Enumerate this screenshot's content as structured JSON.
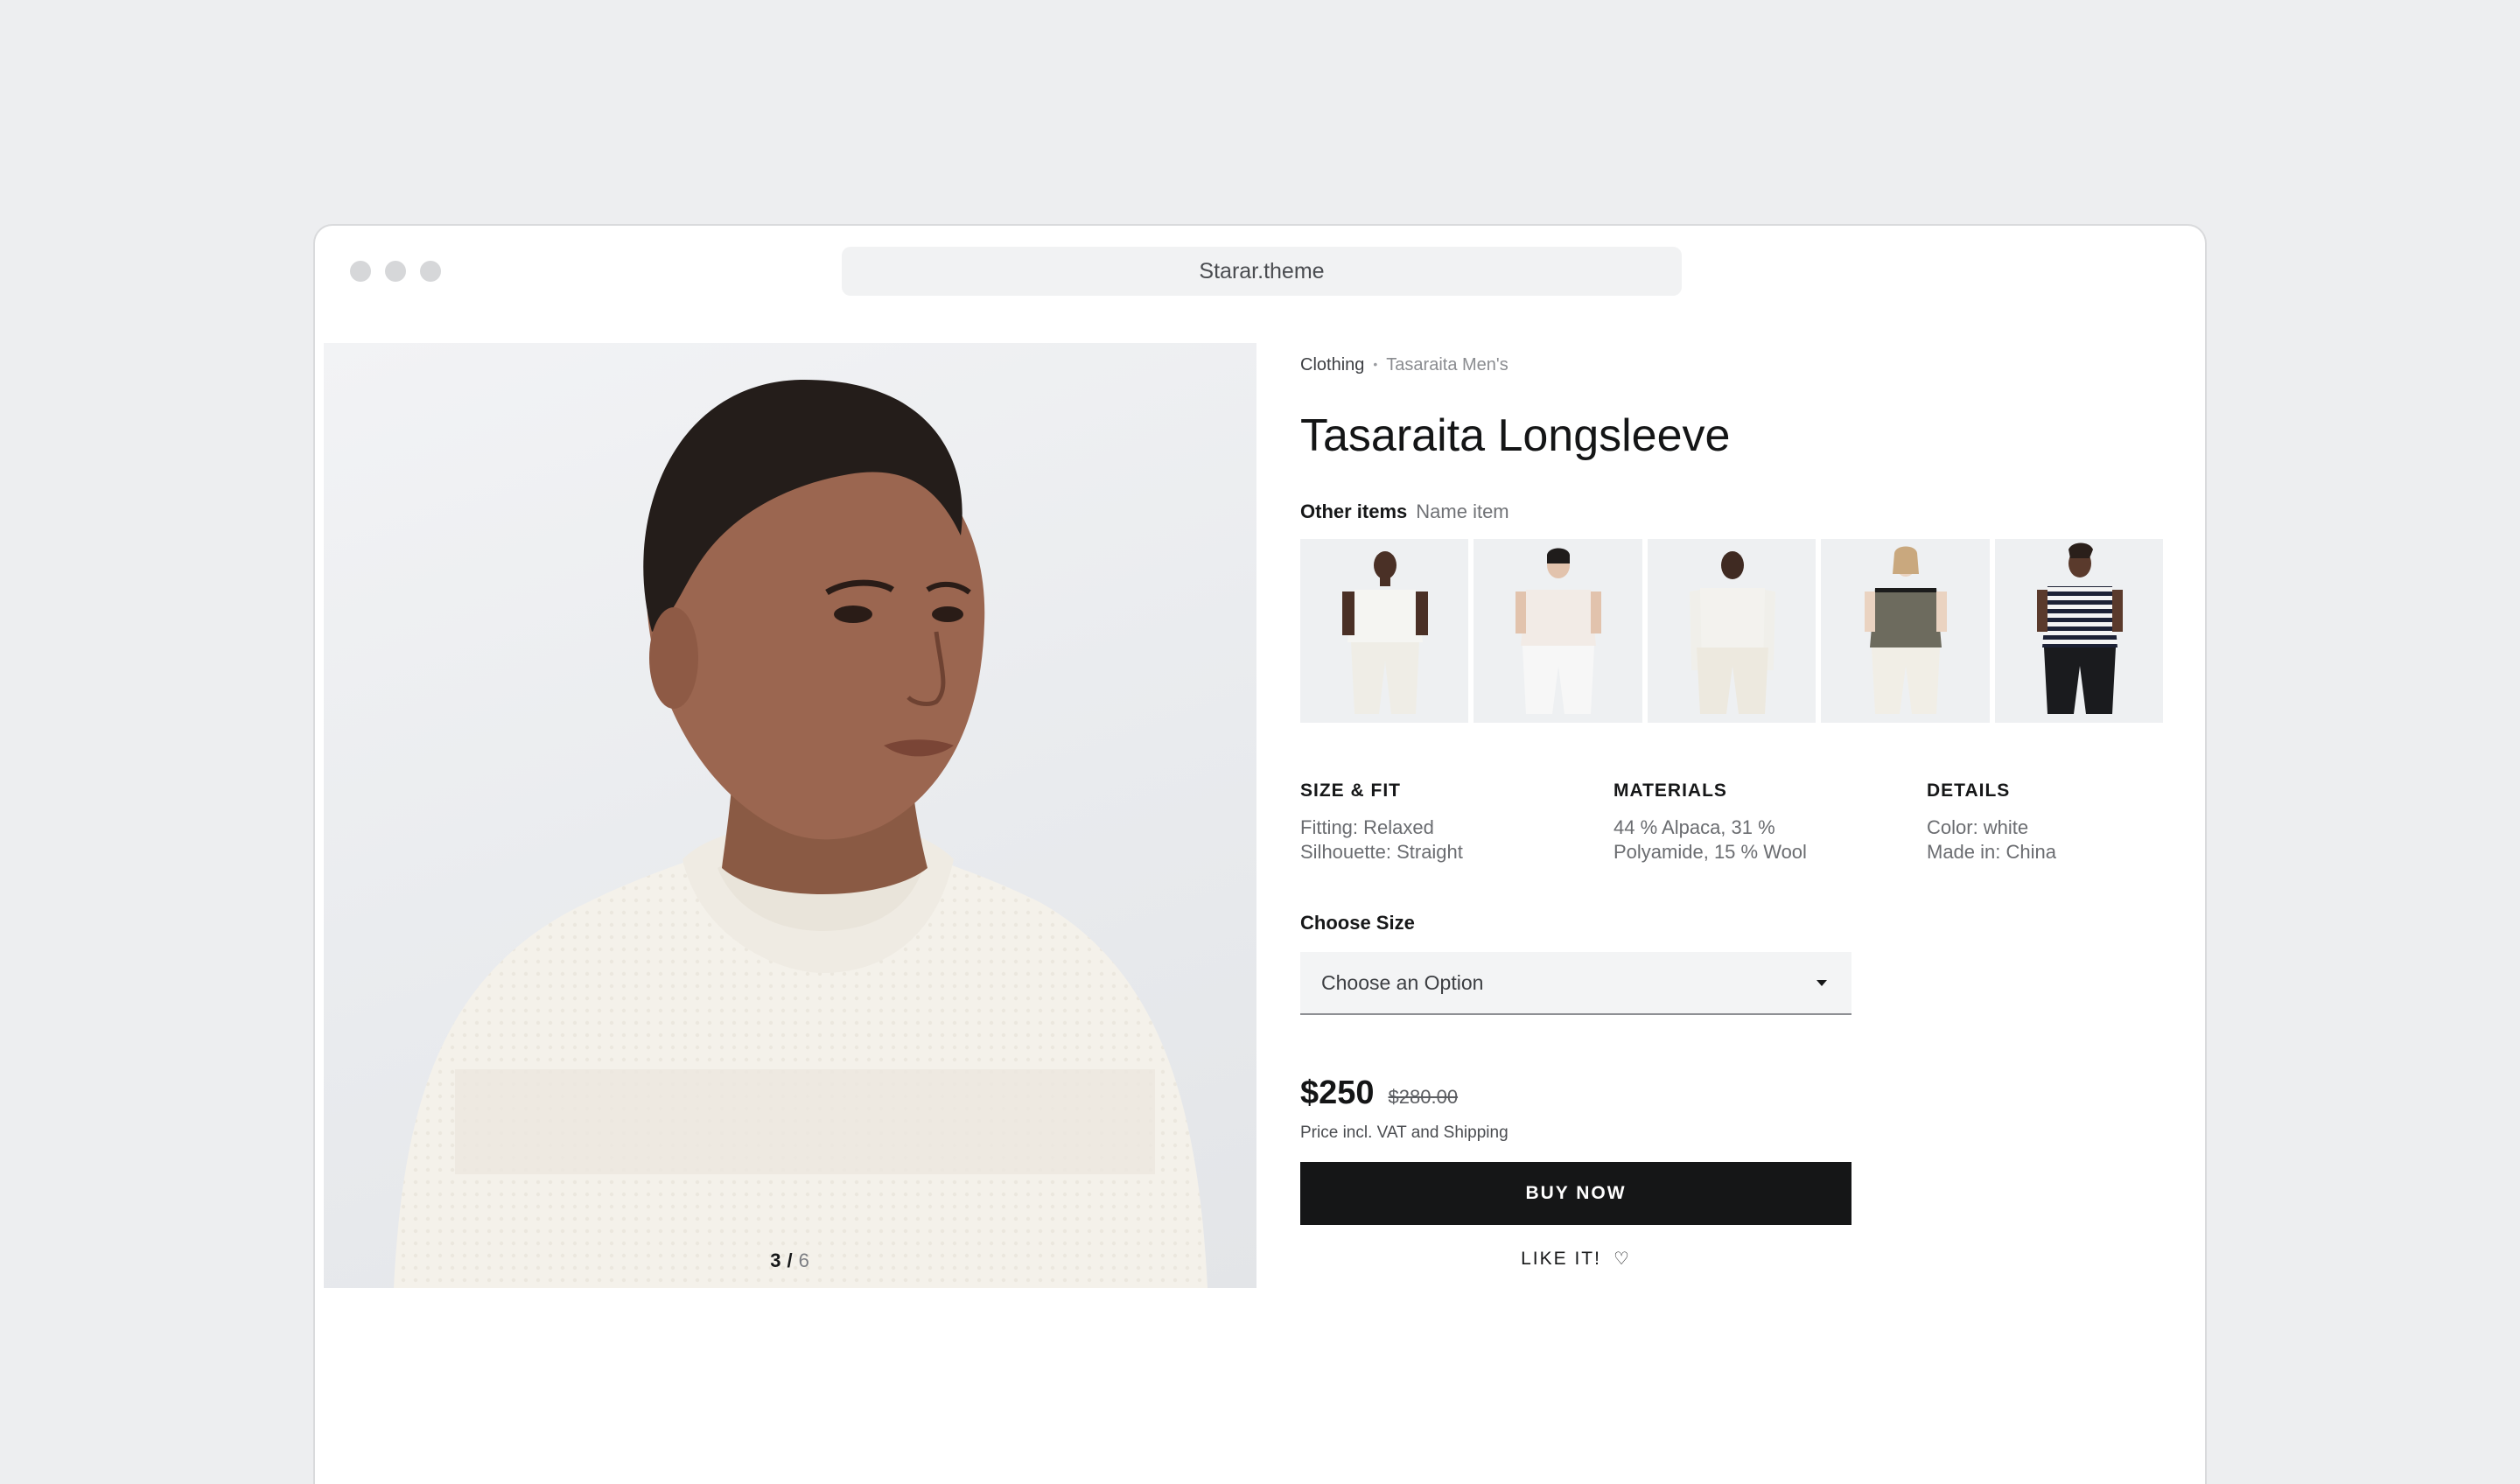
{
  "browser": {
    "address": "Starar.theme"
  },
  "gallery": {
    "current": "3",
    "separator": "/",
    "total": "6"
  },
  "breadcrumb": {
    "items": [
      "Clothing",
      "Tasaraita Men's"
    ],
    "separator": "•"
  },
  "product": {
    "title": "Tasaraita Longsleeve",
    "other_items_label": "Other items",
    "other_items_name": "Name item",
    "thumbnails": [
      "white-tee-model",
      "cream-tee-model",
      "white-longsleeve-model",
      "grey-ringer-tee-model",
      "striped-tee-model"
    ],
    "specs": [
      {
        "heading": "SIZE & FIT",
        "lines": [
          "Fitting: Relaxed",
          "Silhouette: Straight"
        ]
      },
      {
        "heading": "MATERIALS",
        "lines": [
          "44 % Alpaca, 31 %",
          "Polyamide, 15 % Wool"
        ]
      },
      {
        "heading": "DETAILS",
        "lines": [
          "Color: white",
          "Made in: China"
        ]
      }
    ],
    "size_label": "Choose Size",
    "size_placeholder": "Choose an Option",
    "price": "$250",
    "old_price": "$280.00",
    "price_note": "Price incl. VAT and Shipping",
    "buy_label": "BUY NOW",
    "like_label": "LIKE IT!",
    "like_icon": "heart-icon"
  },
  "colors": {
    "background": "#edeef0",
    "buy_button": "#151617",
    "select_bg": "#f3f4f5"
  }
}
